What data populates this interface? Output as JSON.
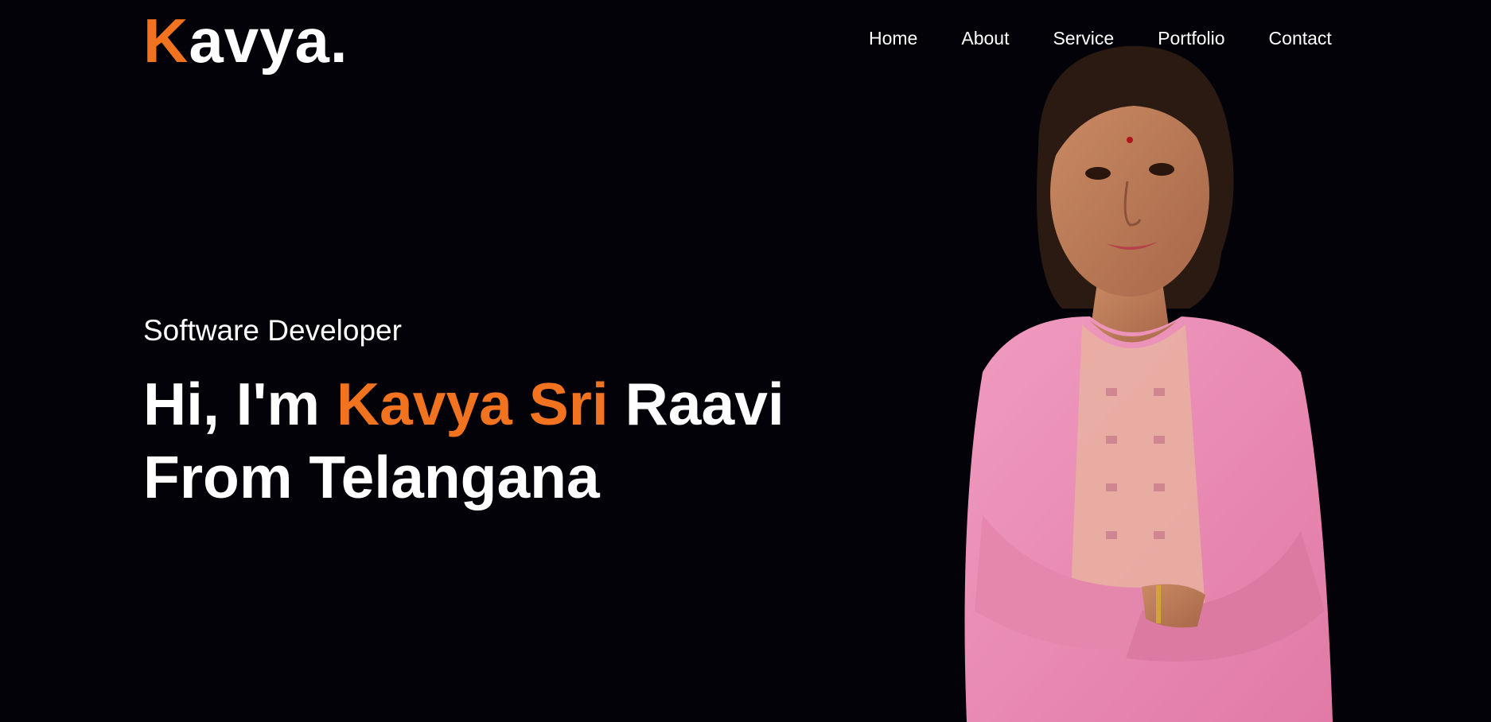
{
  "header": {
    "logo_initial": "K",
    "logo_rest": "avya.",
    "nav": [
      {
        "label": "Home"
      },
      {
        "label": "About"
      },
      {
        "label": "Service"
      },
      {
        "label": "Portfolio"
      },
      {
        "label": "Contact"
      }
    ]
  },
  "hero": {
    "subtitle": "Software Developer",
    "headline_prefix": "Hi, I'm ",
    "headline_name": "Kavya Sri",
    "headline_surname": " Raavi",
    "headline_line2": "From Telangana"
  },
  "colors": {
    "background": "#020208",
    "accent": "#f2731f",
    "text": "#ffffff",
    "dress": "#e98bb0"
  },
  "portrait": {
    "subject": "woman in pink kurta with crossed arms"
  }
}
